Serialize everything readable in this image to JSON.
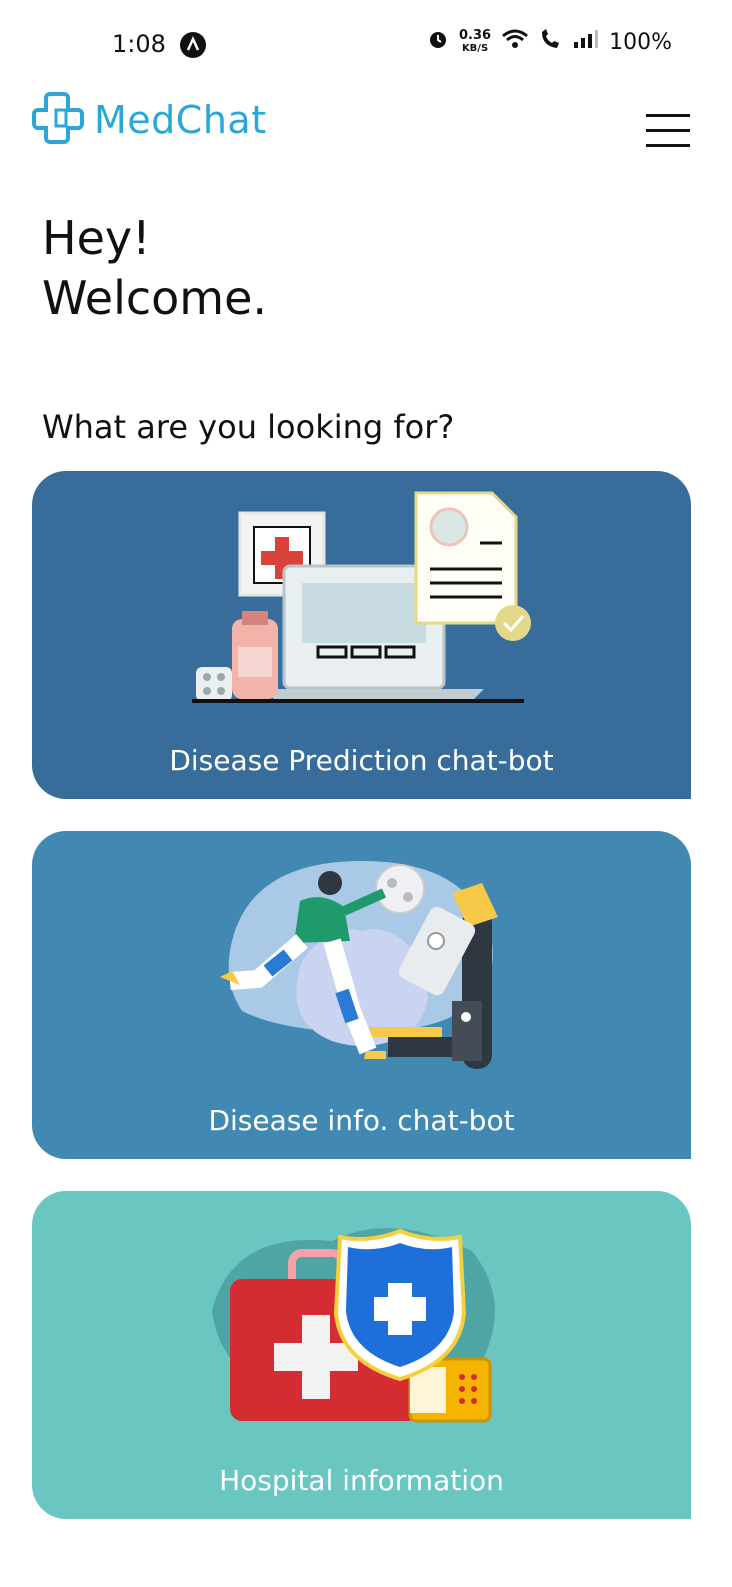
{
  "status_bar": {
    "time": "1:08",
    "app_icon": "a-circle-icon",
    "speed_value": "0.36",
    "speed_unit": "KB/S",
    "battery": "100%",
    "icons": [
      "alarm-icon",
      "wifi-icon",
      "wifi-call-icon",
      "signal-icon"
    ]
  },
  "header": {
    "app_name": "MedChat",
    "logo_icon": "medical-cross-logo-icon",
    "menu_icon": "hamburger-menu-icon"
  },
  "greeting": {
    "line1": "Hey!",
    "line2": "Welcome."
  },
  "prompt": "What are you looking for?",
  "cards": [
    {
      "label": "Disease Prediction chat-bot",
      "color": "#376c9b",
      "illustration": "laptop-medical-report-illustration"
    },
    {
      "label": "Disease info. chat-bot",
      "color": "#4189b3",
      "illustration": "virus-research-microscope-illustration"
    },
    {
      "label": "Hospital information",
      "color": "#69c6c1",
      "illustration": "first-aid-kit-shield-illustration"
    }
  ],
  "colors": {
    "brand": "#2aa7d8",
    "text": "#111111"
  }
}
